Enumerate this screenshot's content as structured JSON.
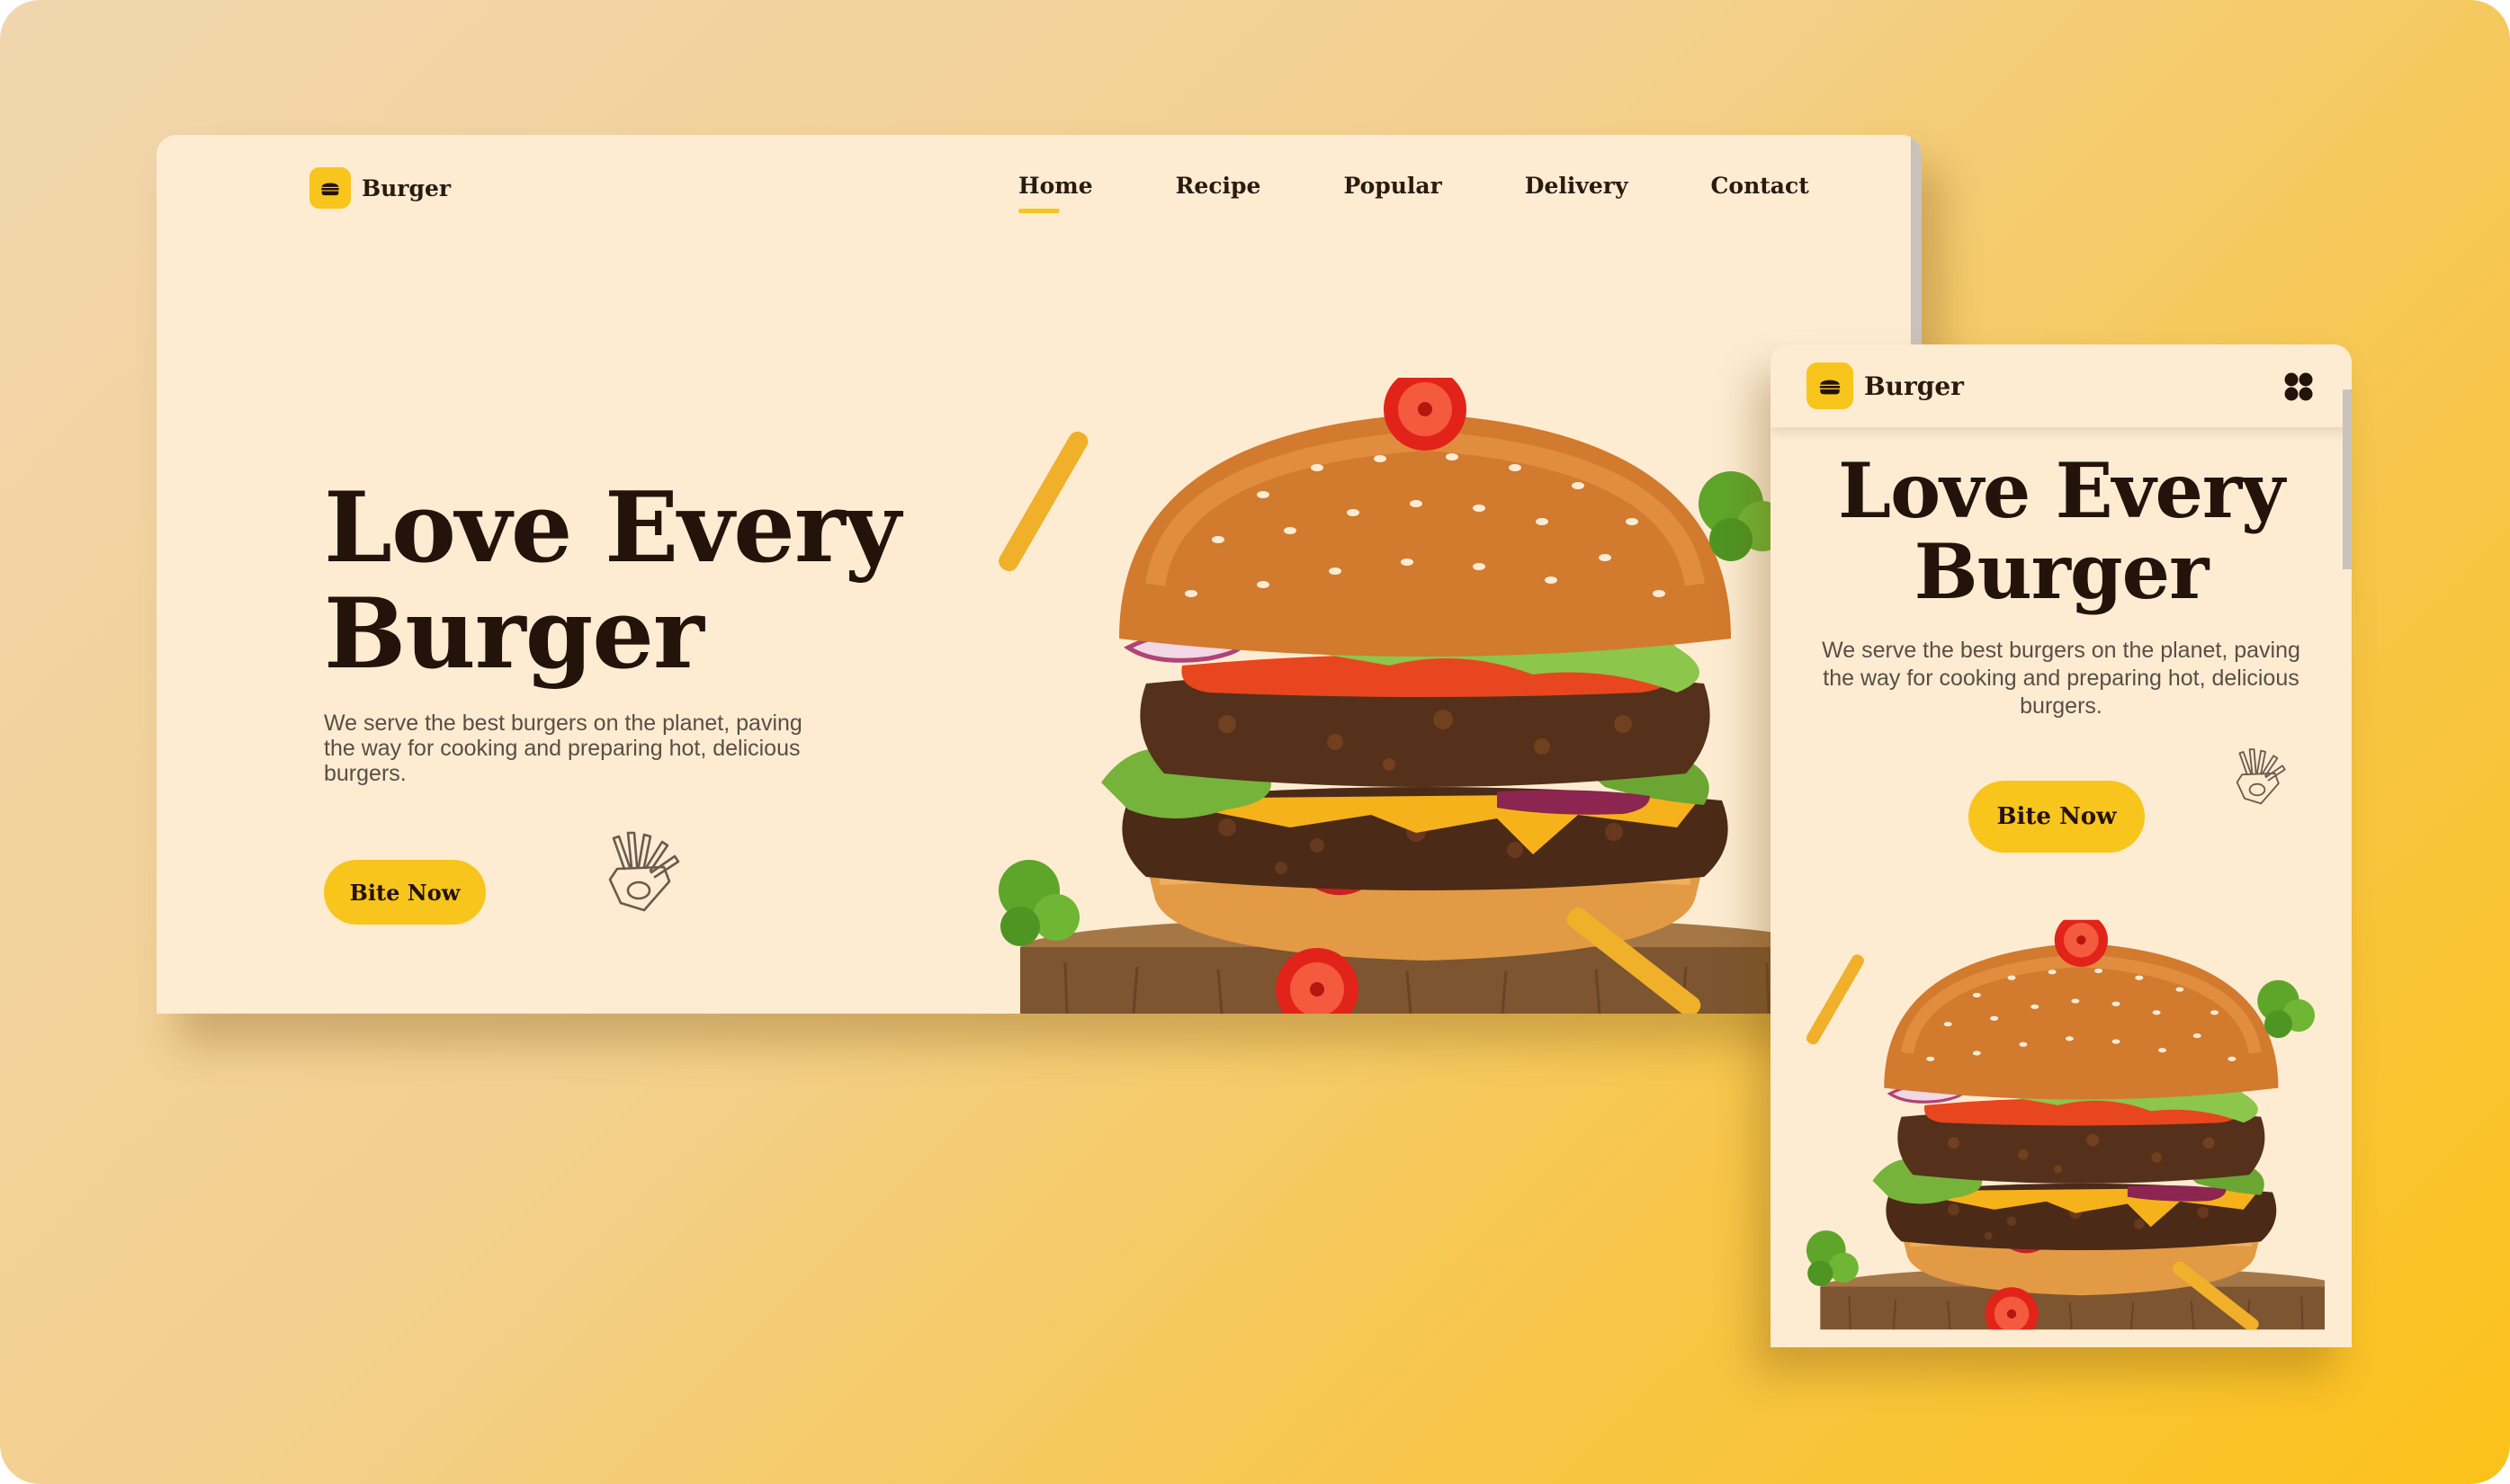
{
  "brand": {
    "name": "Burger",
    "accent": "#f8c51c",
    "text_color": "#24130b"
  },
  "desktop": {
    "nav": [
      {
        "label": "Home",
        "active": true
      },
      {
        "label": "Recipe",
        "active": false
      },
      {
        "label": "Popular",
        "active": false
      },
      {
        "label": "Delivery",
        "active": false
      },
      {
        "label": "Contact",
        "active": false
      }
    ],
    "hero": {
      "title_line1": "Love Every",
      "title_line2": "Burger",
      "description": "We serve the best burgers on the planet, paving the way for cooking and preparing hot, delicious burgers.",
      "cta_label": "Bite Now"
    },
    "illustration": "burger-photo",
    "decor_icon": "fries-icon"
  },
  "mobile": {
    "menu_icon": "grid-menu-icon",
    "hero": {
      "title_line1": "Love Every",
      "title_line2": "Burger",
      "description": "We serve the best burgers on the planet, paving the way for cooking and preparing hot, delicious burgers.",
      "cta_label": "Bite Now"
    },
    "illustration": "burger-photo",
    "decor_icon": "fries-icon"
  }
}
